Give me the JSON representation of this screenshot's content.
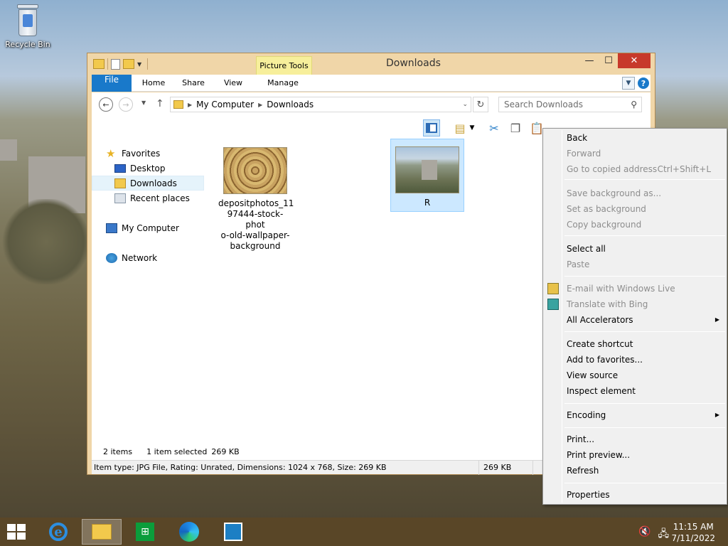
{
  "desktop": {
    "recycle_bin_label": "Recycle Bin"
  },
  "window": {
    "title": "Downloads",
    "contextual_tab_group": "Picture Tools",
    "controls": {
      "minimize": "—",
      "maximize": "☐",
      "close": "✕"
    },
    "ribbon_tabs": [
      "File",
      "Home",
      "Share",
      "View",
      "Manage"
    ],
    "address": {
      "crumbs": [
        "My Computer",
        "Downloads"
      ]
    },
    "search": {
      "placeholder": "Search Downloads"
    },
    "nav": {
      "favorites": "Favorites",
      "desktop": "Desktop",
      "downloads": "Downloads",
      "recent_places": "Recent places",
      "my_computer": "My Computer",
      "network": "Network"
    },
    "files": [
      {
        "name": "depositphotos_11\n97444-stock-phot\no-old-wallpaper-\nbackground",
        "selected": false
      },
      {
        "name": "R",
        "selected": true
      }
    ],
    "status": {
      "items": "2 items",
      "selected": "1 item selected",
      "size": "269 KB"
    },
    "details": {
      "info": "Item type: JPG File, Rating: Unrated, Dimensions: 1024 x 768, Size: 269 KB",
      "size": "269 KB"
    }
  },
  "context_menu": {
    "back": "Back",
    "forward": "Forward",
    "go_to_copied": "Go to copied address",
    "go_to_copied_shortcut": "Ctrl+Shift+L",
    "save_background": "Save background as...",
    "set_background": "Set as background",
    "copy_background": "Copy background",
    "select_all": "Select all",
    "paste": "Paste",
    "email_live": "E-mail with Windows Live",
    "translate_bing": "Translate with Bing",
    "all_accelerators": "All Accelerators",
    "create_shortcut": "Create shortcut",
    "add_favorites": "Add to favorites...",
    "view_source": "View source",
    "inspect_element": "Inspect element",
    "encoding": "Encoding",
    "print": "Print...",
    "print_preview": "Print preview...",
    "refresh": "Refresh",
    "properties": "Properties"
  },
  "taskbar": {
    "time": "11:15 AM",
    "date": "7/11/2022"
  }
}
